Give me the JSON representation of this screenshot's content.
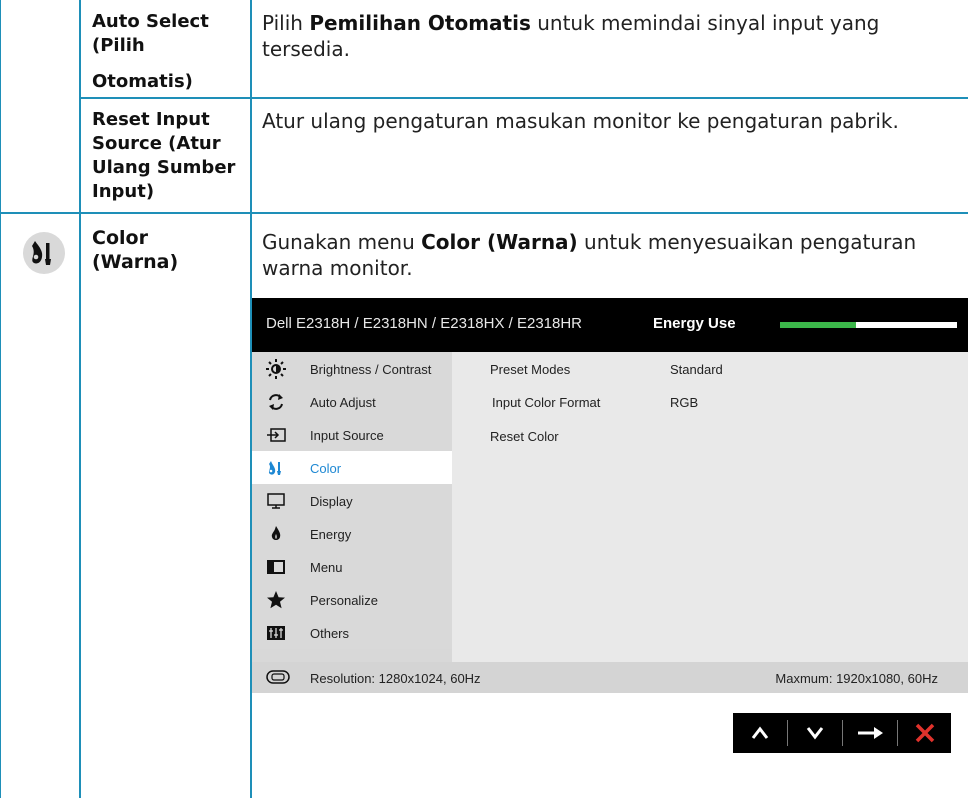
{
  "rows": {
    "auto_select": {
      "label_line1": "Auto Select",
      "label_line2": "(Pilih",
      "label_line3": "Otomatis)",
      "desc_pre": "Pilih ",
      "desc_bold": "Pemilihan Otomatis",
      "desc_post": " untuk memindai sinyal input yang",
      "desc_line2": "tersedia."
    },
    "reset_input": {
      "label_line1": "Reset Input",
      "label_line2": "Source (Atur",
      "label_line3": "Ulang Sumber",
      "label_line4": "Input)",
      "desc": "Atur ulang pengaturan masukan monitor ke pengaturan pabrik."
    },
    "color": {
      "label_line1": "Color",
      "label_line2": "(Warna)",
      "desc_pre": "Gunakan menu ",
      "desc_bold": "Color (Warna)",
      "desc_post": " untuk menyesuaikan pengaturan",
      "desc_line2": "warna monitor.",
      "icon": "color-palette-icon"
    }
  },
  "osd": {
    "title": "Dell E2318H / E2318HN / E2318HX / E2318HR",
    "energy_label": "Energy Use",
    "energy_level": 0.43,
    "menu": [
      {
        "label": "Brightness / Contrast",
        "icon": "brightness-icon"
      },
      {
        "label": "Auto Adjust",
        "icon": "auto-adjust-icon"
      },
      {
        "label": "Input Source",
        "icon": "input-source-icon"
      },
      {
        "label": "Color",
        "icon": "color-icon",
        "active": true
      },
      {
        "label": "Display",
        "icon": "display-icon"
      },
      {
        "label": "Energy",
        "icon": "energy-icon"
      },
      {
        "label": "Menu",
        "icon": "menu-icon"
      },
      {
        "label": "Personalize",
        "icon": "star-icon"
      },
      {
        "label": "Others",
        "icon": "others-icon"
      }
    ],
    "submenu": {
      "preset_modes": {
        "label": "Preset Modes",
        "value": "Standard"
      },
      "input_color_format": {
        "label": "Input Color Format",
        "value": "RGB"
      },
      "reset_color": {
        "label": "Reset Color"
      }
    },
    "footer": {
      "resolution": "Resolution: 1280x1024, 60Hz",
      "maximum": "Maxmum: 1920x1080, 60Hz"
    },
    "nav_buttons": [
      "up-arrow-icon",
      "down-arrow-icon",
      "right-arrow-icon",
      "close-icon"
    ]
  },
  "colors": {
    "rule": "#1e8fb8",
    "energy": "#3cb64a",
    "active": "#1e88d3",
    "close": "#e1322c"
  }
}
